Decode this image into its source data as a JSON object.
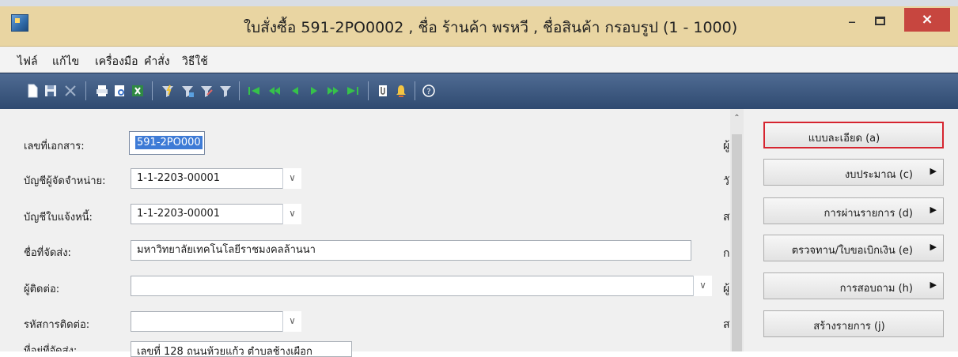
{
  "window": {
    "title": "ใบสั่งซื้อ 591-2PO0002 , ชื่อ ร้านค้า พรหวี , ชื่อสินค้า กรอบรูป (1 - 1000)",
    "minimize": "–",
    "close": "×"
  },
  "menu": [
    "ไฟล์",
    "แก้ไข",
    "เครื่องมือ",
    "คำสั่ง",
    "วิธีใช้"
  ],
  "toolbar": {
    "icons": [
      "new-icon",
      "save-icon",
      "delete-icon",
      "print-icon",
      "preview-icon",
      "export-icon",
      "filter-icon",
      "filter-add-icon",
      "filter-edit-icon",
      "filter-clear-icon",
      "first-record-icon",
      "prev-page-icon",
      "prev-record-icon",
      "next-record-icon",
      "next-page-icon",
      "last-record-icon",
      "attach-icon",
      "alert-icon",
      "help-icon"
    ]
  },
  "form": {
    "doc_no_label": "เลขที่เอกสาร:",
    "doc_no_value": "591-2PO000",
    "vendor_account_label": "บัญชีผู้จัดจำหน่าย:",
    "vendor_account_value": "1-1-2203-00001",
    "invoice_account_label": "บัญชีใบแจ้งหนี้:",
    "invoice_account_value": "1-1-2203-00001",
    "delivery_name_label": "ชื่อที่จัดส่ง:",
    "delivery_name_value": "มหาวิทยาลัยเทคโนโลยีราชมงคลล้านนา",
    "contact_label": "ผู้ติดต่อ:",
    "contact_value": "",
    "contact_code_label": "รหัสการติดต่อ:",
    "contact_code_value": "",
    "address_label": "ที่อยู่ที่จัดส่ง:",
    "address_value": "เลขที่ 128 ถนนห้วยแก้ว ตำบลช้างเผือก"
  },
  "clipped_labels": [
    "ผู้",
    "วั",
    "ส",
    "ก",
    "ผู้",
    "ส"
  ],
  "actions": [
    {
      "label": "แบบละเอียด (a)",
      "has_submenu": false
    },
    {
      "label": "งบประมาณ (c)",
      "has_submenu": true
    },
    {
      "label": "การผ่านรายการ (d)",
      "has_submenu": true
    },
    {
      "label": "ตรวจทาน/ใบขอเบิกเงิน (e)",
      "has_submenu": true
    },
    {
      "label": "การสอบถาม (h)",
      "has_submenu": true
    },
    {
      "label": "สร้างรายการ (j)",
      "has_submenu": false
    }
  ],
  "colors": {
    "titlebar": "#e9d5a2",
    "toolbar": "#3a5680",
    "close": "#c7463f",
    "highlight_border": "#d62530",
    "selection": "#3e7bd6"
  }
}
